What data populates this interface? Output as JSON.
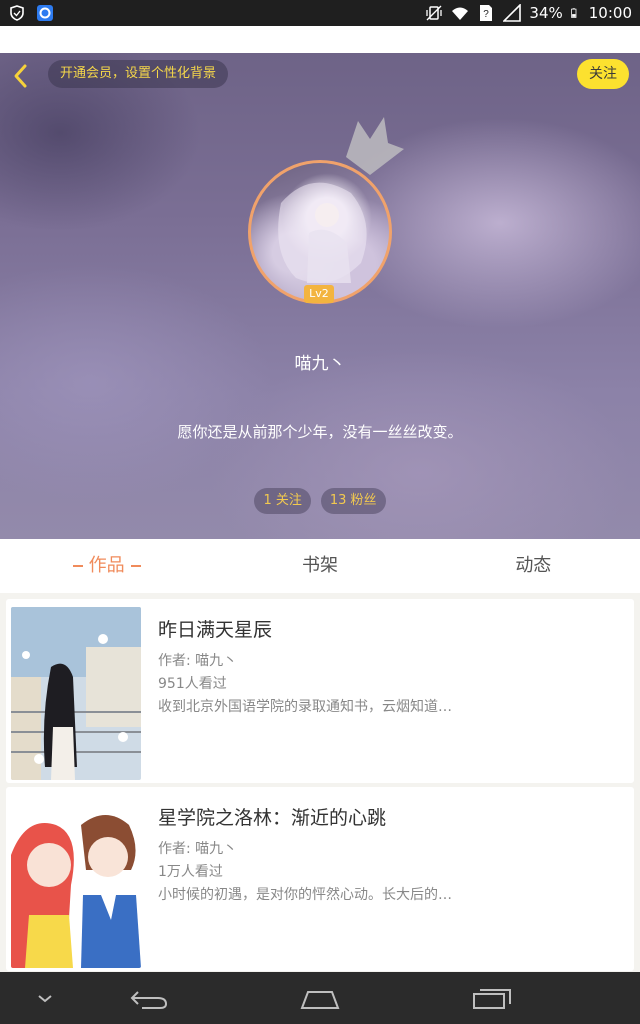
{
  "status_bar": {
    "battery": "34%",
    "time": "10:00",
    "icons": [
      "shield-icon",
      "browser-icon",
      "vibrate-icon",
      "wifi-icon",
      "sim-question-icon",
      "signal-icon",
      "battery-icon"
    ]
  },
  "header": {
    "vip_text": "开通会员，设置个性化背景",
    "follow_label": "关注",
    "level": "Lv2",
    "username": "喵九丶",
    "bio": "愿你还是从前那个少年，没有一丝丝改变。",
    "following": "1 关注",
    "fans": "13 粉丝",
    "colors": {
      "accent": "#fce12f",
      "avatar_ring": "#f0a26b",
      "pill_text": "#f2c94f"
    }
  },
  "tabs": [
    {
      "label": "作品",
      "active": true
    },
    {
      "label": "书架",
      "active": false
    },
    {
      "label": "动态",
      "active": false
    }
  ],
  "books": [
    {
      "title": "昨日满天星辰",
      "author": "作者: 喵九丶",
      "views": "951人看过",
      "summary": "收到北京外国语学院的录取通知书，云烟知道…"
    },
    {
      "title": "星学院之洛林：渐近的心跳",
      "author": "作者: 喵九丶",
      "views": "1万人看过",
      "summary": "小时候的初遇，是对你的怦然心动。长大后的…"
    }
  ],
  "nav": [
    "collapse-icon",
    "back-icon",
    "home-icon",
    "recents-icon"
  ]
}
